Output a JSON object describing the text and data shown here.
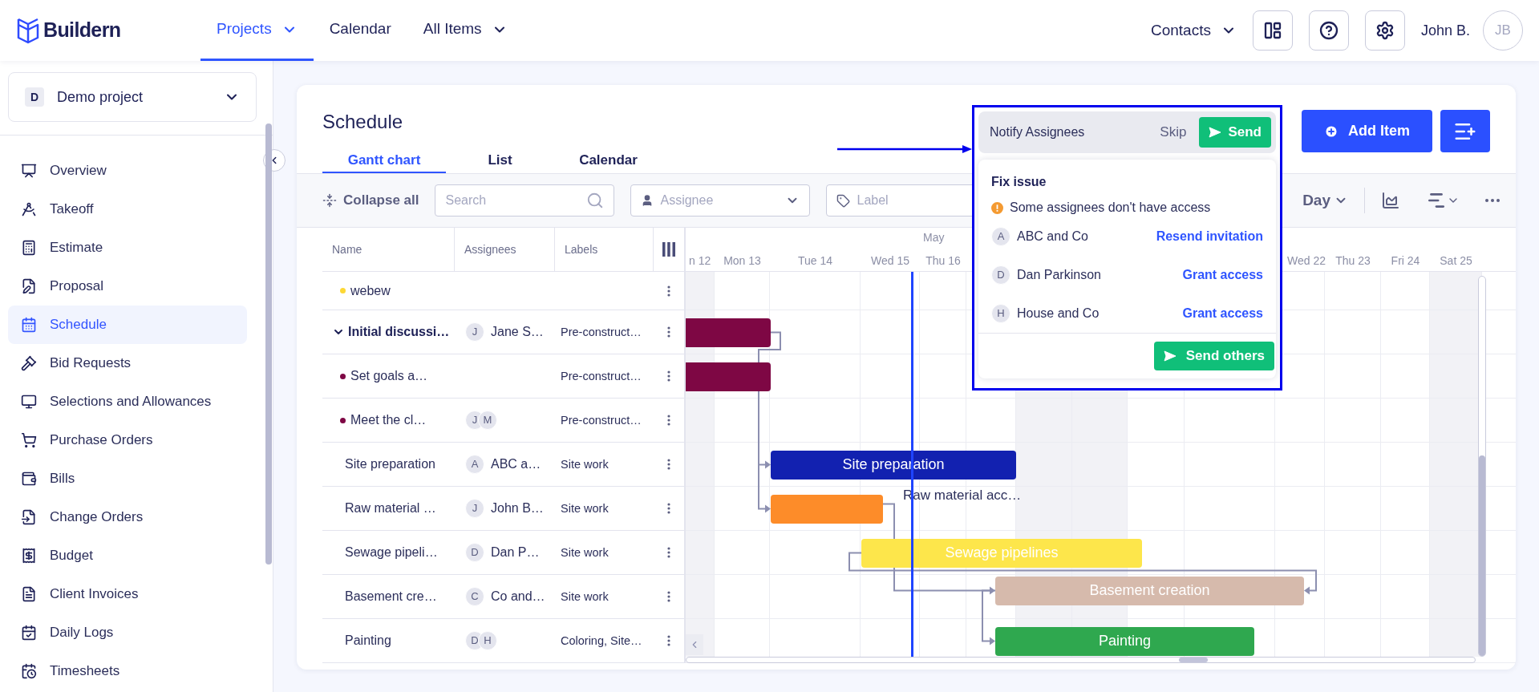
{
  "brand": {
    "name": "Buildern"
  },
  "nav": [
    {
      "label": "Projects",
      "selected": true,
      "has_menu": true
    },
    {
      "label": "Calendar",
      "selected": false,
      "has_menu": false
    },
    {
      "label": "All Items",
      "selected": false,
      "has_menu": true
    }
  ],
  "header_right": {
    "contacts": "Contacts",
    "user": "John B.",
    "initials": "JB"
  },
  "sidebar": {
    "project": {
      "initial": "D",
      "name": "Demo project"
    },
    "items": [
      {
        "label": "Overview",
        "selected": false
      },
      {
        "label": "Takeoff",
        "selected": false
      },
      {
        "label": "Estimate",
        "selected": false
      },
      {
        "label": "Proposal",
        "selected": false
      },
      {
        "label": "Schedule",
        "selected": true
      },
      {
        "label": "Bid Requests",
        "selected": false
      },
      {
        "label": "Selections and Allowances",
        "selected": false
      },
      {
        "label": "Purchase Orders",
        "selected": false
      },
      {
        "label": "Bills",
        "selected": false
      },
      {
        "label": "Change Orders",
        "selected": false
      },
      {
        "label": "Budget",
        "selected": false
      },
      {
        "label": "Client Invoices",
        "selected": false
      },
      {
        "label": "Daily Logs",
        "selected": false
      },
      {
        "label": "Timesheets",
        "selected": false
      }
    ]
  },
  "schedule": {
    "title": "Schedule",
    "tabs": [
      {
        "label": "Gantt chart",
        "selected": true
      },
      {
        "label": "List",
        "selected": false
      },
      {
        "label": "Calendar",
        "selected": false
      }
    ],
    "add_item": "Add Item",
    "toolbar": {
      "collapse": "Collapse all",
      "search_placeholder": "Search",
      "assignee_placeholder": "Assignee",
      "label_placeholder": "Label",
      "scale": "Day"
    },
    "table": {
      "columns": [
        "Name",
        "Assignees",
        "Labels"
      ],
      "rows": [
        {
          "kind": "subtask",
          "name": "webew",
          "dot": {
            "color": "#fdd835"
          }
        },
        {
          "kind": "group",
          "name": "Initial discussi…",
          "expanded": true,
          "assignees": [
            "J"
          ],
          "assignee_name": "Jane S…",
          "labels": "Pre-construct…",
          "bar": {
            "color": "#7e0744"
          }
        },
        {
          "kind": "subtask",
          "name": "Set goals a…",
          "dot": {
            "color": "#7e0744"
          },
          "labels": "Pre-construct…",
          "bar": {
            "color": "#7e0744"
          }
        },
        {
          "kind": "subtask",
          "name": "Meet the cl…",
          "dot": {
            "color": "#7e0744"
          },
          "assignees": [
            "J",
            "M"
          ],
          "labels": "Pre-construct…"
        },
        {
          "kind": "task",
          "name": "Site preparation",
          "assignees": [
            "A"
          ],
          "assignee_name": "ABC a…",
          "labels": "Site work",
          "bar": {
            "color": "#1221b0",
            "label": "Site preparation",
            "kind": "inside"
          }
        },
        {
          "kind": "task",
          "name": "Raw material …",
          "assignees": [
            "J"
          ],
          "assignee_name": "John B…",
          "labels": "Site work",
          "bar": {
            "color": "#fd8c29",
            "label": "Raw material acc…",
            "kind": "outside"
          }
        },
        {
          "kind": "task",
          "name": "Sewage pipeli…",
          "assignees": [
            "D"
          ],
          "assignee_name": "Dan P…",
          "labels": "Site work",
          "bar": {
            "color": "#fde64b",
            "label": "Sewage pipelines",
            "kind": "inside"
          }
        },
        {
          "kind": "task",
          "name": "Basement cre…",
          "assignees": [
            "C"
          ],
          "assignee_name": "Co and…",
          "labels": "Site work",
          "bar": {
            "color": "#d6baac",
            "label": "Basement creation",
            "kind": "inside"
          }
        },
        {
          "kind": "task",
          "name": "Painting",
          "assignees": [
            "D",
            "H"
          ],
          "labels": "Coloring, Site…",
          "bar": {
            "color": "#2fa84f",
            "label": "Painting",
            "kind": "inside"
          }
        }
      ]
    },
    "timeline": {
      "month": "May",
      "days": [
        {
          "label": "n 12",
          "weekend": true
        },
        {
          "label": "Mon 13",
          "weekend": false
        },
        {
          "label": "Tue 14",
          "weekend": false
        },
        {
          "label": "Wed 15",
          "weekend": false
        },
        {
          "label": "Thu 16",
          "weekend": false
        },
        {
          "weekend": false
        },
        {
          "weekend": true
        },
        {
          "weekend": true
        },
        {
          "weekend": false
        },
        {
          "weekend": false
        },
        {
          "label": "Wed 22",
          "weekend": false
        },
        {
          "label": "Thu 23",
          "weekend": false
        },
        {
          "label": "Fri 24",
          "weekend": false
        },
        {
          "label": "Sat 25",
          "weekend": true
        }
      ]
    }
  },
  "notify": {
    "title": "Notify Assignees",
    "skip": "Skip",
    "send": "Send",
    "fix_title": "Fix issue",
    "warning": "Some assignees don't have access",
    "people": [
      {
        "initial": "A",
        "name": "ABC and Co",
        "action": "Resend invitation"
      },
      {
        "initial": "D",
        "name": "Dan Parkinson",
        "action": "Grant access"
      },
      {
        "initial": "H",
        "name": "House and Co",
        "action": "Grant access"
      }
    ],
    "send_others": "Send others"
  }
}
